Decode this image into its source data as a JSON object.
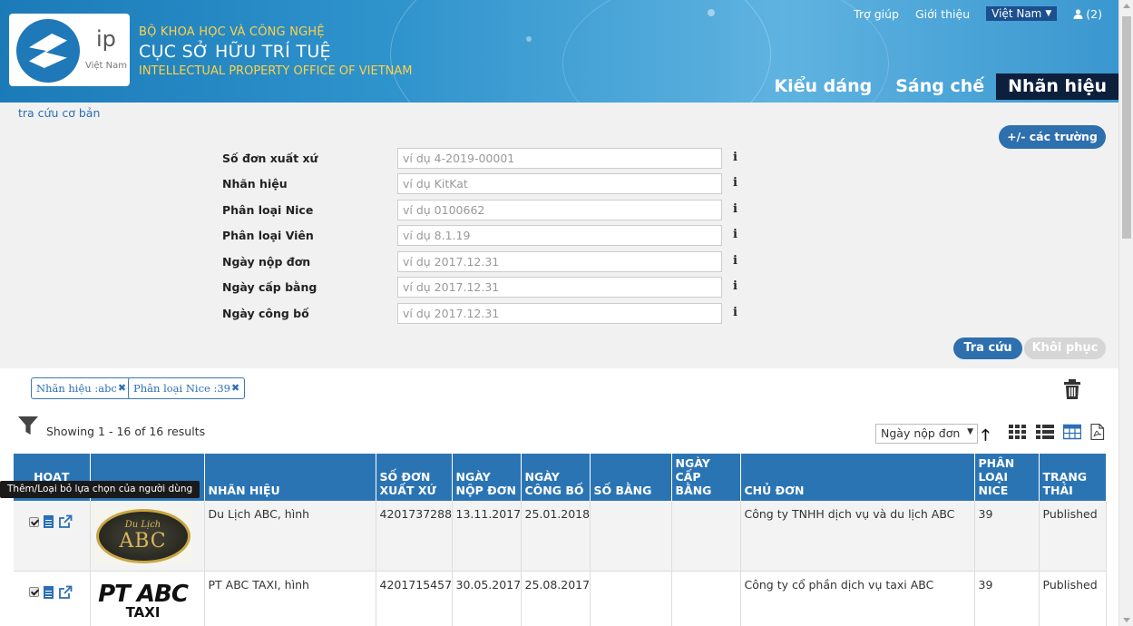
{
  "header": {
    "logo_text": "ip",
    "logo_sub": "Việt Nam",
    "org_line1": "BỘ KHOA HỌC VÀ CÔNG NGHỆ",
    "org_line2": "CỤC SỞ HỮU TRÍ TUỆ",
    "org_line3": "INTELLECTUAL PROPERTY OFFICE OF VIETNAM",
    "links": {
      "help": "Trợ giúp",
      "about": "Giới thiệu"
    },
    "language": "Việt Nam",
    "user_count": "(2)",
    "tabs": [
      {
        "label": "Kiểu dáng",
        "active": false
      },
      {
        "label": "Sáng chế",
        "active": false
      },
      {
        "label": "Nhãn hiệu",
        "active": true
      }
    ]
  },
  "breadcrumb": "tra cứu cơ bản",
  "fields_button": "+/- các trường",
  "form": {
    "rows": [
      {
        "label": "Số đơn xuất xứ",
        "placeholder": "ví dụ 4-2019-00001"
      },
      {
        "label": "Nhãn hiệu",
        "placeholder": "ví dụ KitKat"
      },
      {
        "label": "Phân loại Nice",
        "placeholder": "ví dụ 0100662"
      },
      {
        "label": "Phân loại Viên",
        "placeholder": "ví dụ 8.1.19"
      },
      {
        "label": "Ngày nộp đơn",
        "placeholder": "ví dụ 2017.12.31"
      },
      {
        "label": "Ngày cấp bằng",
        "placeholder": "ví dụ 2017.12.31"
      },
      {
        "label": "Ngày công bố",
        "placeholder": "ví dụ 2017.12.31"
      }
    ],
    "info_glyph": "i"
  },
  "buttons": {
    "search": "Tra cứu",
    "reset": "Khôi phục"
  },
  "filters": [
    {
      "label": "Nhãn hiệu :abc",
      "close": "✖"
    },
    {
      "label": "Phân loại Nice :39",
      "close": "✖"
    }
  ],
  "showing": "Showing 1 - 16 of 16 results",
  "sort": {
    "selected": "Ngày nộp đơn",
    "caret": "▼",
    "direction_glyph": "🡑"
  },
  "table": {
    "headers": {
      "action": "HOẠT ĐỘNG",
      "logo": "LOGO",
      "mark": "NHÃN HIỆU",
      "app_no": "SỐ ĐƠN XUẤT XỨ",
      "filing_date": "NGÀY NỘP ĐƠN",
      "pub_date": "NGÀY CÔNG BỐ",
      "reg_no": "SỐ BẰNG",
      "reg_date": "NGÀY CẤP BẰNG",
      "owner": "CHỦ ĐƠN",
      "nice": "PHÂN LOẠI NICE",
      "status": "TRẠNG THÁI"
    },
    "rows": [
      {
        "logo_line1": "Du Lịch",
        "logo_line2": "ABC",
        "mark": "Du Lịch ABC, hình",
        "app_no": "4201737288",
        "filing_date": "13.11.2017",
        "pub_date": "25.01.2018",
        "reg_no": "",
        "reg_date": "",
        "owner": "Công ty TNHH dịch vụ và du lịch ABC",
        "nice": "39",
        "status": "Published"
      },
      {
        "logo_line1": "PT ABC",
        "logo_line2": "TAXI",
        "mark": "PT ABC TAXI, hình",
        "app_no": "4201715457",
        "filing_date": "30.05.2017",
        "pub_date": "25.08.2017",
        "reg_no": "",
        "reg_date": "",
        "owner": "Công ty cổ phần dịch vụ taxi ABC",
        "nice": "39",
        "status": "Published"
      }
    ]
  },
  "tooltip": "Thêm/Loại bỏ lựa chọn của người dùng",
  "colors": {
    "primary": "#2a74b4",
    "nav_active": "#0c1f3c",
    "accent_yellow": "#ffd24a"
  }
}
